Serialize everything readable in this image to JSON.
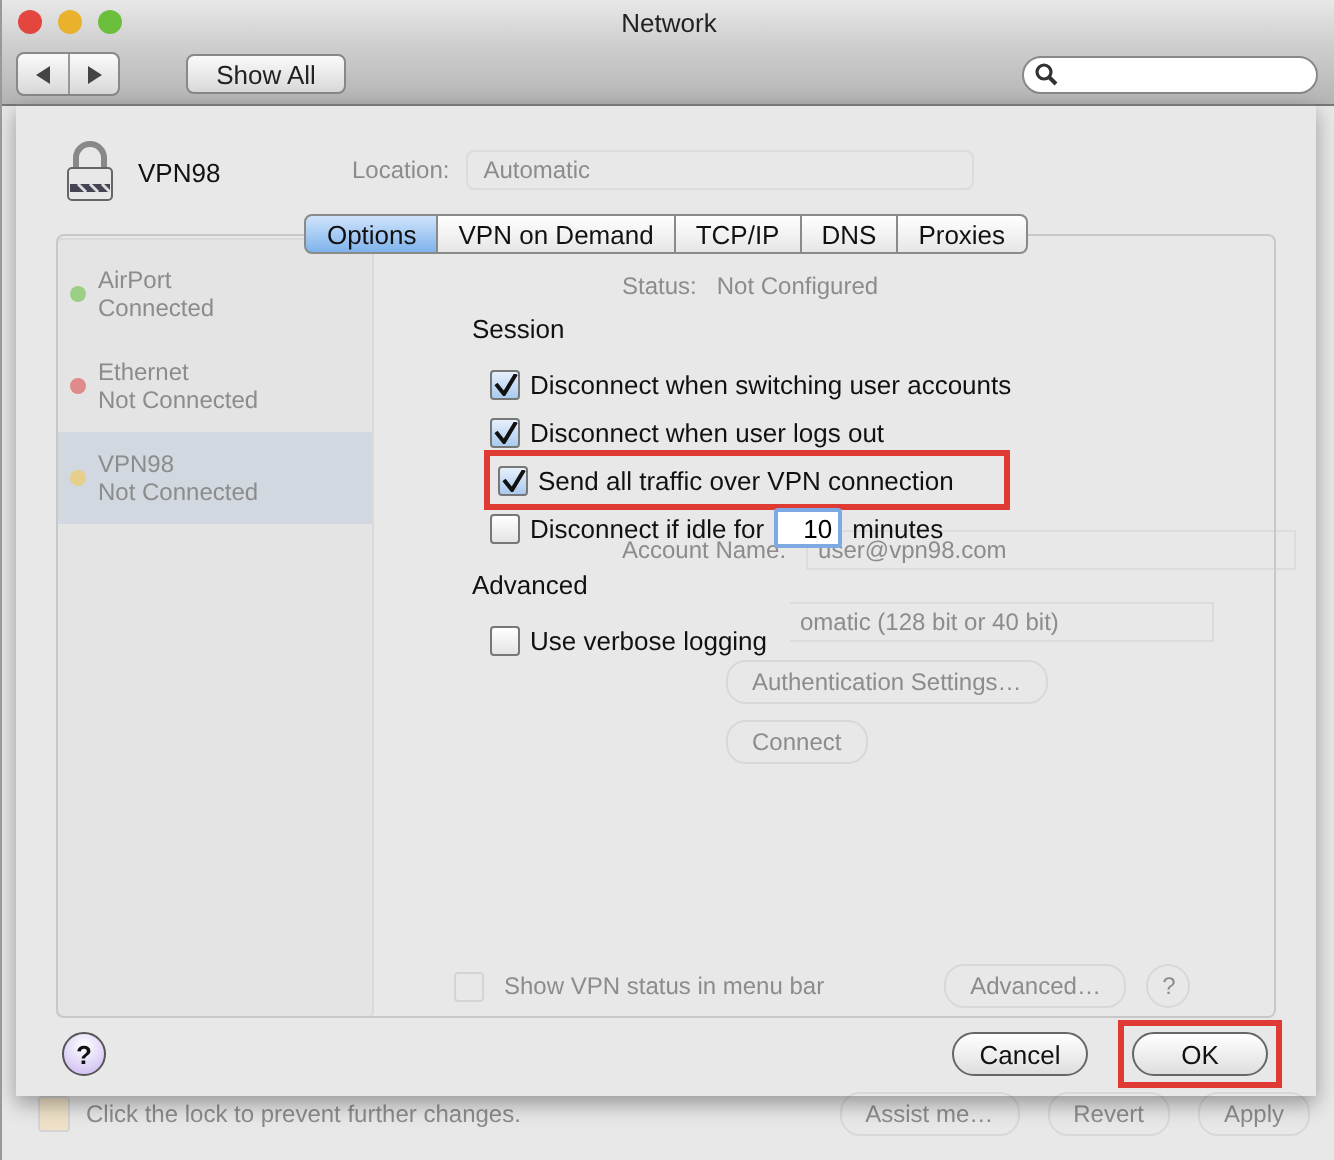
{
  "window": {
    "title": "Network"
  },
  "toolbar": {
    "show_all": "Show All"
  },
  "background": {
    "location": {
      "label": "Location:",
      "value": "Automatic"
    },
    "services": [
      {
        "name": "AirPort",
        "status": "Connected",
        "color": "#9ccf86",
        "selected": false
      },
      {
        "name": "Ethernet",
        "status": "Not Connected",
        "color": "#e08a8a",
        "selected": false
      },
      {
        "name": "VPN98",
        "status": "Not Connected",
        "color": "#e6cf8a",
        "selected": true
      }
    ],
    "status": {
      "label": "Status:",
      "value": "Not Configured"
    },
    "account": {
      "label": "Account Name:",
      "value": "user@vpn98.com"
    },
    "encryption": "omatic (128 bit or 40 bit)",
    "auth_button": "Authentication Settings…",
    "connect_button": "Connect",
    "show_status": {
      "label": "Show VPN status in menu bar",
      "checked": false
    },
    "advanced_button": "Advanced…",
    "help": "?",
    "lock_text": "Click the lock to prevent further changes.",
    "buttons": [
      "Assist me…",
      "Revert",
      "Apply"
    ]
  },
  "sheet": {
    "service": "VPN98",
    "tabs": [
      {
        "label": "Options",
        "selected": true
      },
      {
        "label": "VPN on Demand",
        "selected": false
      },
      {
        "label": "TCP/IP",
        "selected": false
      },
      {
        "label": "DNS",
        "selected": false
      },
      {
        "label": "Proxies",
        "selected": false
      }
    ],
    "sections": [
      {
        "title": "Session",
        "options": [
          {
            "kind": "checkbox",
            "label": "Disconnect when switching user accounts",
            "checked": true,
            "highlighted": false
          },
          {
            "kind": "checkbox",
            "label": "Disconnect when user logs out",
            "checked": true,
            "highlighted": false
          },
          {
            "kind": "checkbox",
            "label": "Send all traffic over VPN connection",
            "checked": true,
            "highlighted": true
          },
          {
            "kind": "idle",
            "label": "Disconnect if idle for",
            "value": "10",
            "unit": "minutes",
            "checked": false,
            "highlighted": false
          }
        ]
      },
      {
        "title": "Advanced",
        "options": [
          {
            "kind": "checkbox",
            "label": "Use verbose logging",
            "checked": false,
            "highlighted": false
          }
        ]
      }
    ],
    "help": "?",
    "buttons": [
      {
        "label": "Cancel",
        "highlighted": false
      },
      {
        "label": "OK",
        "highlighted": true
      }
    ]
  }
}
